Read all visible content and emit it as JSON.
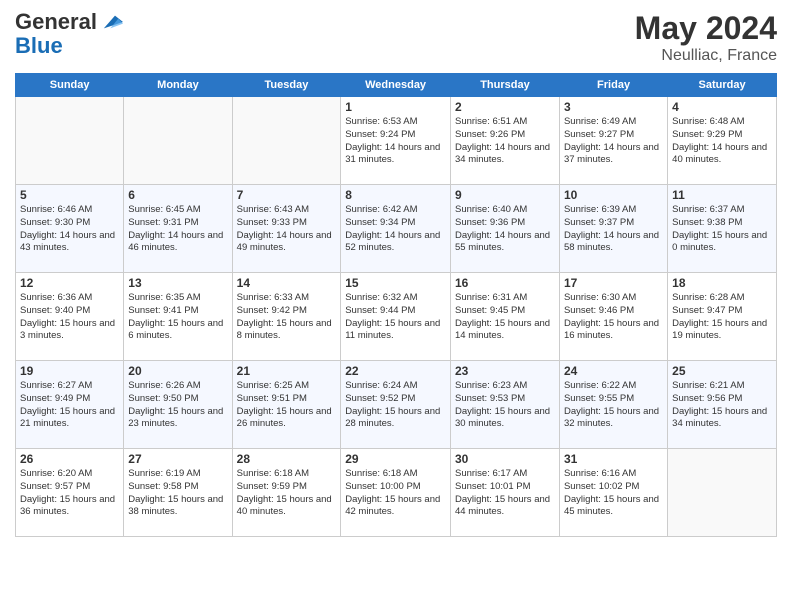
{
  "header": {
    "logo_general": "General",
    "logo_blue": "Blue",
    "month_title": "May 2024",
    "location": "Neulliac, France"
  },
  "days_of_week": [
    "Sunday",
    "Monday",
    "Tuesday",
    "Wednesday",
    "Thursday",
    "Friday",
    "Saturday"
  ],
  "weeks": [
    [
      {
        "day": "",
        "empty": true
      },
      {
        "day": "",
        "empty": true
      },
      {
        "day": "",
        "empty": true
      },
      {
        "day": "1",
        "sunrise": "6:53 AM",
        "sunset": "9:24 PM",
        "daylight": "14 hours and 31 minutes."
      },
      {
        "day": "2",
        "sunrise": "6:51 AM",
        "sunset": "9:26 PM",
        "daylight": "14 hours and 34 minutes."
      },
      {
        "day": "3",
        "sunrise": "6:49 AM",
        "sunset": "9:27 PM",
        "daylight": "14 hours and 37 minutes."
      },
      {
        "day": "4",
        "sunrise": "6:48 AM",
        "sunset": "9:29 PM",
        "daylight": "14 hours and 40 minutes."
      }
    ],
    [
      {
        "day": "5",
        "sunrise": "6:46 AM",
        "sunset": "9:30 PM",
        "daylight": "14 hours and 43 minutes."
      },
      {
        "day": "6",
        "sunrise": "6:45 AM",
        "sunset": "9:31 PM",
        "daylight": "14 hours and 46 minutes."
      },
      {
        "day": "7",
        "sunrise": "6:43 AM",
        "sunset": "9:33 PM",
        "daylight": "14 hours and 49 minutes."
      },
      {
        "day": "8",
        "sunrise": "6:42 AM",
        "sunset": "9:34 PM",
        "daylight": "14 hours and 52 minutes."
      },
      {
        "day": "9",
        "sunrise": "6:40 AM",
        "sunset": "9:36 PM",
        "daylight": "14 hours and 55 minutes."
      },
      {
        "day": "10",
        "sunrise": "6:39 AM",
        "sunset": "9:37 PM",
        "daylight": "14 hours and 58 minutes."
      },
      {
        "day": "11",
        "sunrise": "6:37 AM",
        "sunset": "9:38 PM",
        "daylight": "15 hours and 0 minutes."
      }
    ],
    [
      {
        "day": "12",
        "sunrise": "6:36 AM",
        "sunset": "9:40 PM",
        "daylight": "15 hours and 3 minutes."
      },
      {
        "day": "13",
        "sunrise": "6:35 AM",
        "sunset": "9:41 PM",
        "daylight": "15 hours and 6 minutes."
      },
      {
        "day": "14",
        "sunrise": "6:33 AM",
        "sunset": "9:42 PM",
        "daylight": "15 hours and 8 minutes."
      },
      {
        "day": "15",
        "sunrise": "6:32 AM",
        "sunset": "9:44 PM",
        "daylight": "15 hours and 11 minutes."
      },
      {
        "day": "16",
        "sunrise": "6:31 AM",
        "sunset": "9:45 PM",
        "daylight": "15 hours and 14 minutes."
      },
      {
        "day": "17",
        "sunrise": "6:30 AM",
        "sunset": "9:46 PM",
        "daylight": "15 hours and 16 minutes."
      },
      {
        "day": "18",
        "sunrise": "6:28 AM",
        "sunset": "9:47 PM",
        "daylight": "15 hours and 19 minutes."
      }
    ],
    [
      {
        "day": "19",
        "sunrise": "6:27 AM",
        "sunset": "9:49 PM",
        "daylight": "15 hours and 21 minutes."
      },
      {
        "day": "20",
        "sunrise": "6:26 AM",
        "sunset": "9:50 PM",
        "daylight": "15 hours and 23 minutes."
      },
      {
        "day": "21",
        "sunrise": "6:25 AM",
        "sunset": "9:51 PM",
        "daylight": "15 hours and 26 minutes."
      },
      {
        "day": "22",
        "sunrise": "6:24 AM",
        "sunset": "9:52 PM",
        "daylight": "15 hours and 28 minutes."
      },
      {
        "day": "23",
        "sunrise": "6:23 AM",
        "sunset": "9:53 PM",
        "daylight": "15 hours and 30 minutes."
      },
      {
        "day": "24",
        "sunrise": "6:22 AM",
        "sunset": "9:55 PM",
        "daylight": "15 hours and 32 minutes."
      },
      {
        "day": "25",
        "sunrise": "6:21 AM",
        "sunset": "9:56 PM",
        "daylight": "15 hours and 34 minutes."
      }
    ],
    [
      {
        "day": "26",
        "sunrise": "6:20 AM",
        "sunset": "9:57 PM",
        "daylight": "15 hours and 36 minutes."
      },
      {
        "day": "27",
        "sunrise": "6:19 AM",
        "sunset": "9:58 PM",
        "daylight": "15 hours and 38 minutes."
      },
      {
        "day": "28",
        "sunrise": "6:18 AM",
        "sunset": "9:59 PM",
        "daylight": "15 hours and 40 minutes."
      },
      {
        "day": "29",
        "sunrise": "6:18 AM",
        "sunset": "10:00 PM",
        "daylight": "15 hours and 42 minutes."
      },
      {
        "day": "30",
        "sunrise": "6:17 AM",
        "sunset": "10:01 PM",
        "daylight": "15 hours and 44 minutes."
      },
      {
        "day": "31",
        "sunrise": "6:16 AM",
        "sunset": "10:02 PM",
        "daylight": "15 hours and 45 minutes."
      },
      {
        "day": "",
        "empty": true
      }
    ]
  ]
}
